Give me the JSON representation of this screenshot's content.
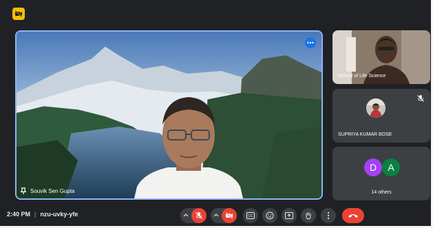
{
  "meeting": {
    "time": "2:40 PM",
    "separator": "|",
    "code": "nzu-uvky-yfe"
  },
  "main_speaker": {
    "name": "Souvik Sen Gupta"
  },
  "side_tiles": [
    {
      "label": "School of Life Science"
    },
    {
      "label": "SUPRIYA KUMAR BOSE"
    },
    {
      "label": "14 others",
      "avatars": [
        "D",
        "A"
      ]
    }
  ],
  "colors": {
    "accent": "#8ab4f8",
    "end_call": "#ea4335",
    "muted": "#ea4335",
    "avatar_d": "#a142f4",
    "avatar_a": "#0b8043",
    "badge": "#fbbc04"
  },
  "icons": {
    "top_badge": "no-camera-icon",
    "more": "more-options-icon",
    "pin": "pin-icon",
    "mic": "mic-off-icon",
    "camera": "camera-off-icon",
    "captions": "captions-icon",
    "emoji": "emoji-icon",
    "present": "present-screen-icon",
    "hand": "raise-hand-icon",
    "more_vert": "more-vert-icon",
    "end_call": "end-call-icon"
  }
}
